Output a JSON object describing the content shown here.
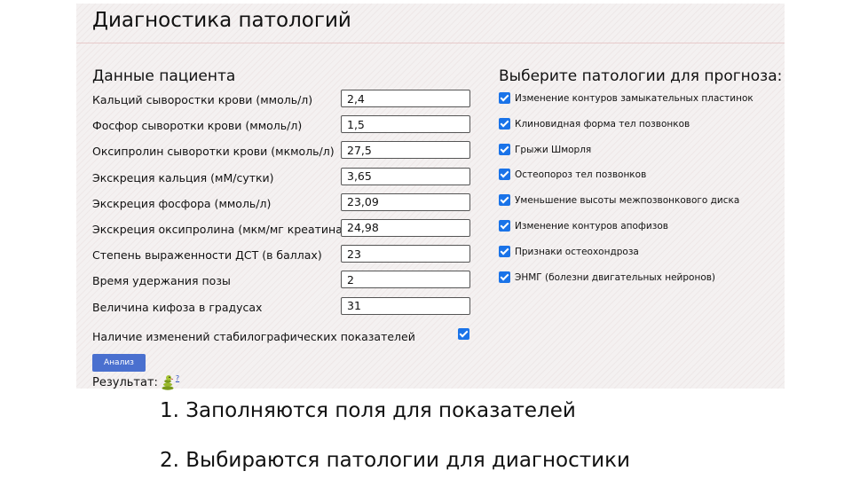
{
  "page": {
    "title": "Диагностика патологий"
  },
  "patient": {
    "section_title": "Данные пациента",
    "fields": [
      {
        "label": "Кальций сыворостки крови (ммоль/л)",
        "value": "2,4"
      },
      {
        "label": "Фосфор сыворотки крови (ммоль/л)",
        "value": "1,5"
      },
      {
        "label": "Оксипролин сыворотки крови (мкмоль/л)",
        "value": "27,5"
      },
      {
        "label": "Экскреция кальция (мМ/сутки)",
        "value": "3,65"
      },
      {
        "label": "Экскреция фосфора (ммоль/л)",
        "value": "23,09"
      },
      {
        "label": "Экскреция оксипролина (мкм/мг креатина)",
        "value": "24,98"
      },
      {
        "label": "Степень выраженности ДСТ (в баллах)",
        "value": "23"
      },
      {
        "label": "Время удержания позы",
        "value": "2"
      },
      {
        "label": "Величина кифоза в градусах",
        "value": "31"
      }
    ],
    "stabilo_label": "Наличие изменений стабилографических показателей",
    "stabilo_checked": true
  },
  "pathologies": {
    "section_title": "Выберите патологии для прогноза:",
    "items": [
      {
        "label": "Изменение контуров замыкательных пластинок",
        "checked": true
      },
      {
        "label": "Клиновидная форма тел позвонков",
        "checked": true
      },
      {
        "label": "Грыжи Шморля",
        "checked": true
      },
      {
        "label": "Остеопороз тел позвонков",
        "checked": true
      },
      {
        "label": "Уменьшение высоты межпозвонкового диска",
        "checked": true
      },
      {
        "label": "Изменение контуров апофизов",
        "checked": true
      },
      {
        "label": "Признаки остеохондроза",
        "checked": true
      },
      {
        "label": "ЭНМГ (болезни двигательных нейронов)",
        "checked": true
      }
    ]
  },
  "actions": {
    "analyze_label": "Анализ"
  },
  "result": {
    "label": "Результат:",
    "icon": "snake-icon",
    "link_text": "?"
  },
  "notes": [
    "1. Заполняются поля для показателей",
    "2. Выбираются патологии для диагностики"
  ],
  "colors": {
    "accent": "#1a73e8",
    "button": "#4a70cf",
    "panel_bg": "#f4f1f1"
  }
}
